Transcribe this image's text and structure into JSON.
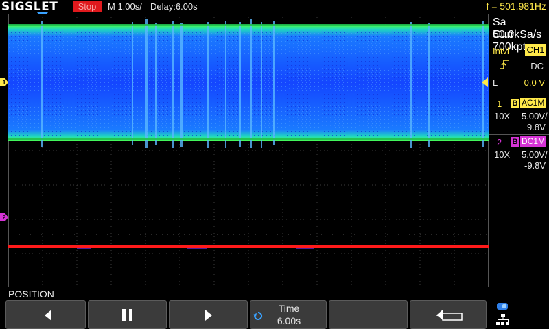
{
  "brand": "SIGSLET",
  "run_state": "Stop",
  "timebase": "M 1.00s/",
  "delay": "Delay:6.00s",
  "frequency": "f = 501.981Hz",
  "acquisition": {
    "sample_rate": "Sa 50.0kSa/s",
    "memory": "Curr 700kpts"
  },
  "trigger": {
    "mode": "Intvl",
    "source": "CH1",
    "slope_icon": "rising-edge-icon",
    "coupling": "DC",
    "level_label": "L",
    "level_value": "0.0 V"
  },
  "channels": [
    {
      "number": "1",
      "bw_badge": "B",
      "coupling": "AC1M",
      "probe": "10X",
      "scale": "5.00V/",
      "offset": "9.8V",
      "color": "#ffe94a"
    },
    {
      "number": "2",
      "bw_badge": "B",
      "coupling": "DC1M",
      "probe": "10X",
      "scale": "5.00V/",
      "offset": "-9.8V",
      "color": "#d633d6"
    }
  ],
  "markers": {
    "ch1": "1",
    "ch2": "2"
  },
  "menu_title": "POSITION",
  "softkeys": {
    "left_icon": "arrow-left-icon",
    "pause_icon": "pause-icon",
    "right_icon": "arrow-right-icon",
    "time_title": "Time",
    "time_value": "6.00s",
    "back_icon": "return-icon"
  },
  "colors": {
    "stop": "#e0191d",
    "ch1_trace": "#1f5bff",
    "ch1_envelope": "#20e0a0",
    "ch2_trace": "#ff1a1a",
    "grid": "#3c3c3c"
  }
}
